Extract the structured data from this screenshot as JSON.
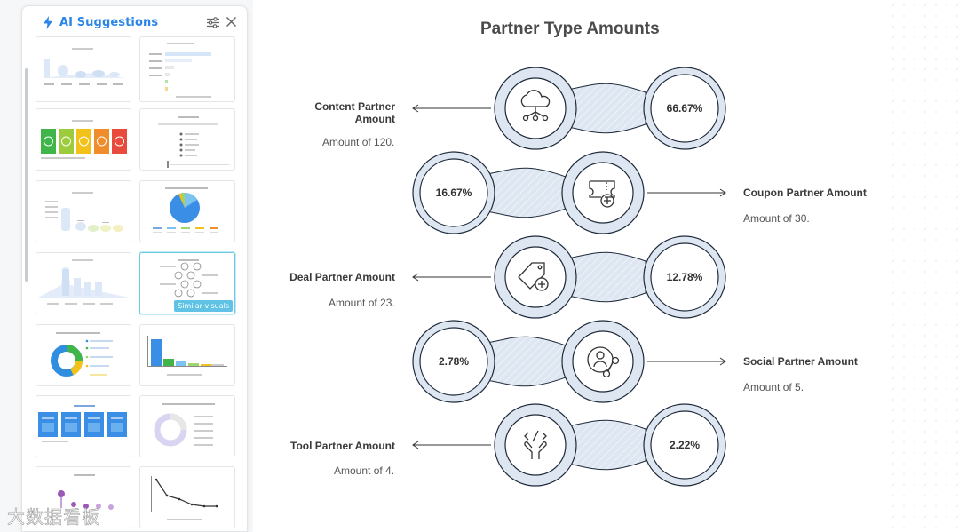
{
  "panel": {
    "title": "AI Suggestions",
    "selected_badge": "Similar visuals"
  },
  "infographic": {
    "title": "Partner Type Amounts",
    "items": [
      {
        "name": "Content Partner Amount",
        "desc": "Amount of 120.",
        "pct": "66.67%",
        "icon": "cloud-network-icon"
      },
      {
        "name": "Coupon Partner Amount",
        "desc": "Amount of 30.",
        "pct": "16.67%",
        "icon": "ticket-plus-icon"
      },
      {
        "name": "Deal Partner Amount",
        "desc": "Amount of 23.",
        "pct": "12.78%",
        "icon": "tag-plus-icon"
      },
      {
        "name": "Social Partner Amount",
        "desc": "Amount of 5.",
        "pct": "2.78%",
        "icon": "user-share-icon"
      },
      {
        "name": "Tool Partner Amount",
        "desc": "Amount of 4.",
        "pct": "2.22%",
        "icon": "code-hands-icon"
      }
    ]
  },
  "watermark": "大数据看板",
  "colors": {
    "accent": "#2c86e8",
    "node_stroke": "#1e2a3a",
    "fill": "#dde6f1"
  }
}
